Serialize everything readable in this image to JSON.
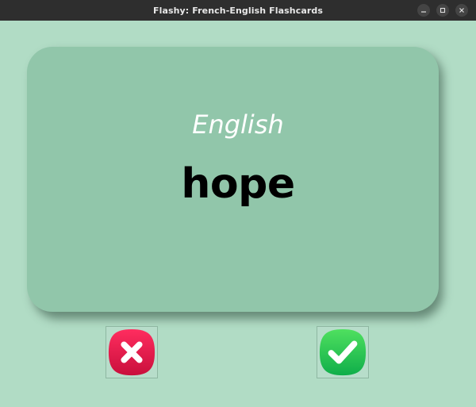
{
  "window": {
    "title": "Flashy: French-English Flashcards",
    "controls": [
      "minimize-icon",
      "maximize-icon",
      "close-icon"
    ]
  },
  "colors": {
    "background": "#b1dcc5",
    "card": "#91c6aa",
    "wrong": "#e0174a",
    "right": "#22c253"
  },
  "card": {
    "title": "English",
    "word": "hope"
  },
  "buttons": {
    "wrong_icon": "x-mark-icon",
    "right_icon": "checkmark-icon"
  }
}
